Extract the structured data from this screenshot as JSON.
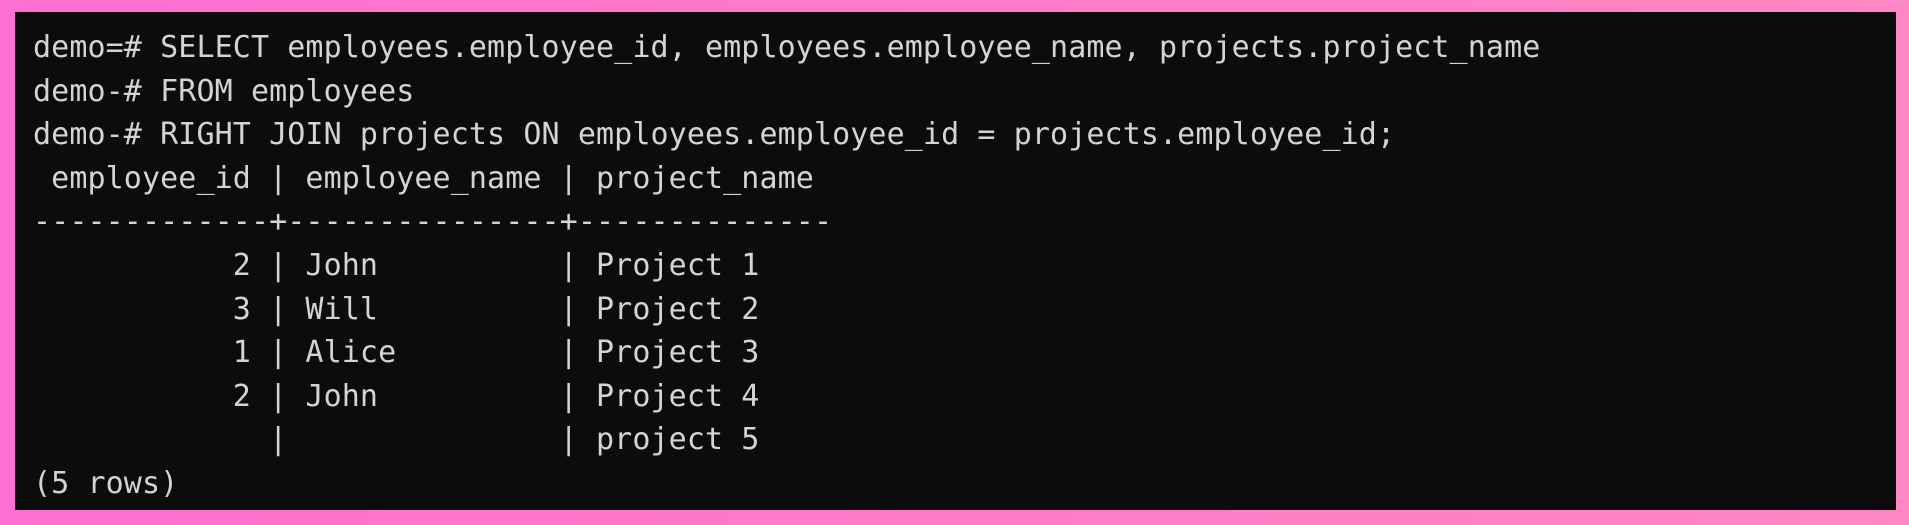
{
  "terminal": {
    "lines": [
      "demo=# SELECT employees.employee_id, employees.employee_name, projects.project_name",
      "demo-# FROM employees",
      "demo-# RIGHT JOIN projects ON employees.employee_id = projects.employee_id;",
      " employee_id | employee_name | project_name",
      "-------------+---------------+--------------",
      "           2 | John          | Project 1",
      "           3 | Will          | Project 2",
      "           1 | Alice         | Project 3",
      "           2 | John          | Project 4",
      "             |               | project 5",
      "(5 rows)"
    ]
  },
  "colors": {
    "background": "#0c0c0c",
    "text": "#d4d4d4",
    "frame_gradient_start": "#ff6fd1",
    "frame_gradient_end": "#ff86c4"
  }
}
